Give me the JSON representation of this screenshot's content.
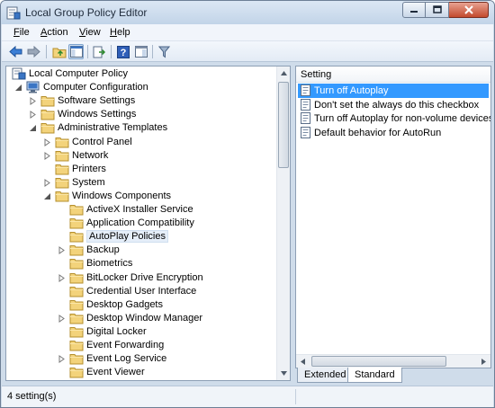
{
  "window": {
    "title": "Local Group Policy Editor"
  },
  "menu": [
    {
      "key": "F",
      "rest": "ile"
    },
    {
      "key": "A",
      "rest": "ction"
    },
    {
      "key": "V",
      "rest": "iew"
    },
    {
      "key": "H",
      "rest": "elp"
    }
  ],
  "tree": {
    "items": [
      {
        "label": "Local Computer Policy",
        "level": 0,
        "expander": "none",
        "icon": "computer-policy"
      },
      {
        "label": "Computer Configuration",
        "level": 1,
        "expander": "expanded",
        "icon": "computer"
      },
      {
        "label": "Software Settings",
        "level": 2,
        "expander": "collapsed",
        "icon": "folder"
      },
      {
        "label": "Windows Settings",
        "level": 2,
        "expander": "collapsed",
        "icon": "folder"
      },
      {
        "label": "Administrative Templates",
        "level": 2,
        "expander": "expanded",
        "icon": "folder"
      },
      {
        "label": "Control Panel",
        "level": 3,
        "expander": "collapsed",
        "icon": "folder"
      },
      {
        "label": "Network",
        "level": 3,
        "expander": "collapsed",
        "icon": "folder"
      },
      {
        "label": "Printers",
        "level": 3,
        "expander": "none",
        "icon": "folder"
      },
      {
        "label": "System",
        "level": 3,
        "expander": "collapsed",
        "icon": "folder"
      },
      {
        "label": "Windows Components",
        "level": 3,
        "expander": "expanded",
        "icon": "folder"
      },
      {
        "label": "ActiveX Installer Service",
        "level": 4,
        "expander": "none",
        "icon": "folder"
      },
      {
        "label": "Application Compatibility",
        "level": 4,
        "expander": "none",
        "icon": "folder"
      },
      {
        "label": "AutoPlay Policies",
        "level": 4,
        "expander": "none",
        "icon": "folder",
        "selected": true
      },
      {
        "label": "Backup",
        "level": 4,
        "expander": "collapsed",
        "icon": "folder"
      },
      {
        "label": "Biometrics",
        "level": 4,
        "expander": "none",
        "icon": "folder"
      },
      {
        "label": "BitLocker Drive Encryption",
        "level": 4,
        "expander": "collapsed",
        "icon": "folder"
      },
      {
        "label": "Credential User Interface",
        "level": 4,
        "expander": "none",
        "icon": "folder"
      },
      {
        "label": "Desktop Gadgets",
        "level": 4,
        "expander": "none",
        "icon": "folder"
      },
      {
        "label": "Desktop Window Manager",
        "level": 4,
        "expander": "collapsed",
        "icon": "folder"
      },
      {
        "label": "Digital Locker",
        "level": 4,
        "expander": "none",
        "icon": "folder"
      },
      {
        "label": "Event Forwarding",
        "level": 4,
        "expander": "none",
        "icon": "folder"
      },
      {
        "label": "Event Log Service",
        "level": 4,
        "expander": "collapsed",
        "icon": "folder"
      },
      {
        "label": "Event Viewer",
        "level": 4,
        "expander": "none",
        "icon": "folder"
      }
    ]
  },
  "settings": {
    "column_header": "Setting",
    "items": [
      {
        "label": "Turn off Autoplay",
        "selected": true
      },
      {
        "label": "Don't set the always do this checkbox",
        "selected": false
      },
      {
        "label": "Turn off Autoplay for non-volume devices",
        "selected": false
      },
      {
        "label": "Default behavior for AutoRun",
        "selected": false
      }
    ]
  },
  "tabs": {
    "extended": "Extended",
    "standard": "Standard"
  },
  "status": {
    "text": "4 setting(s)"
  },
  "colors": {
    "selection": "#3399ff",
    "folder": "#f3d37b",
    "window_frame": "#cfdcea"
  }
}
